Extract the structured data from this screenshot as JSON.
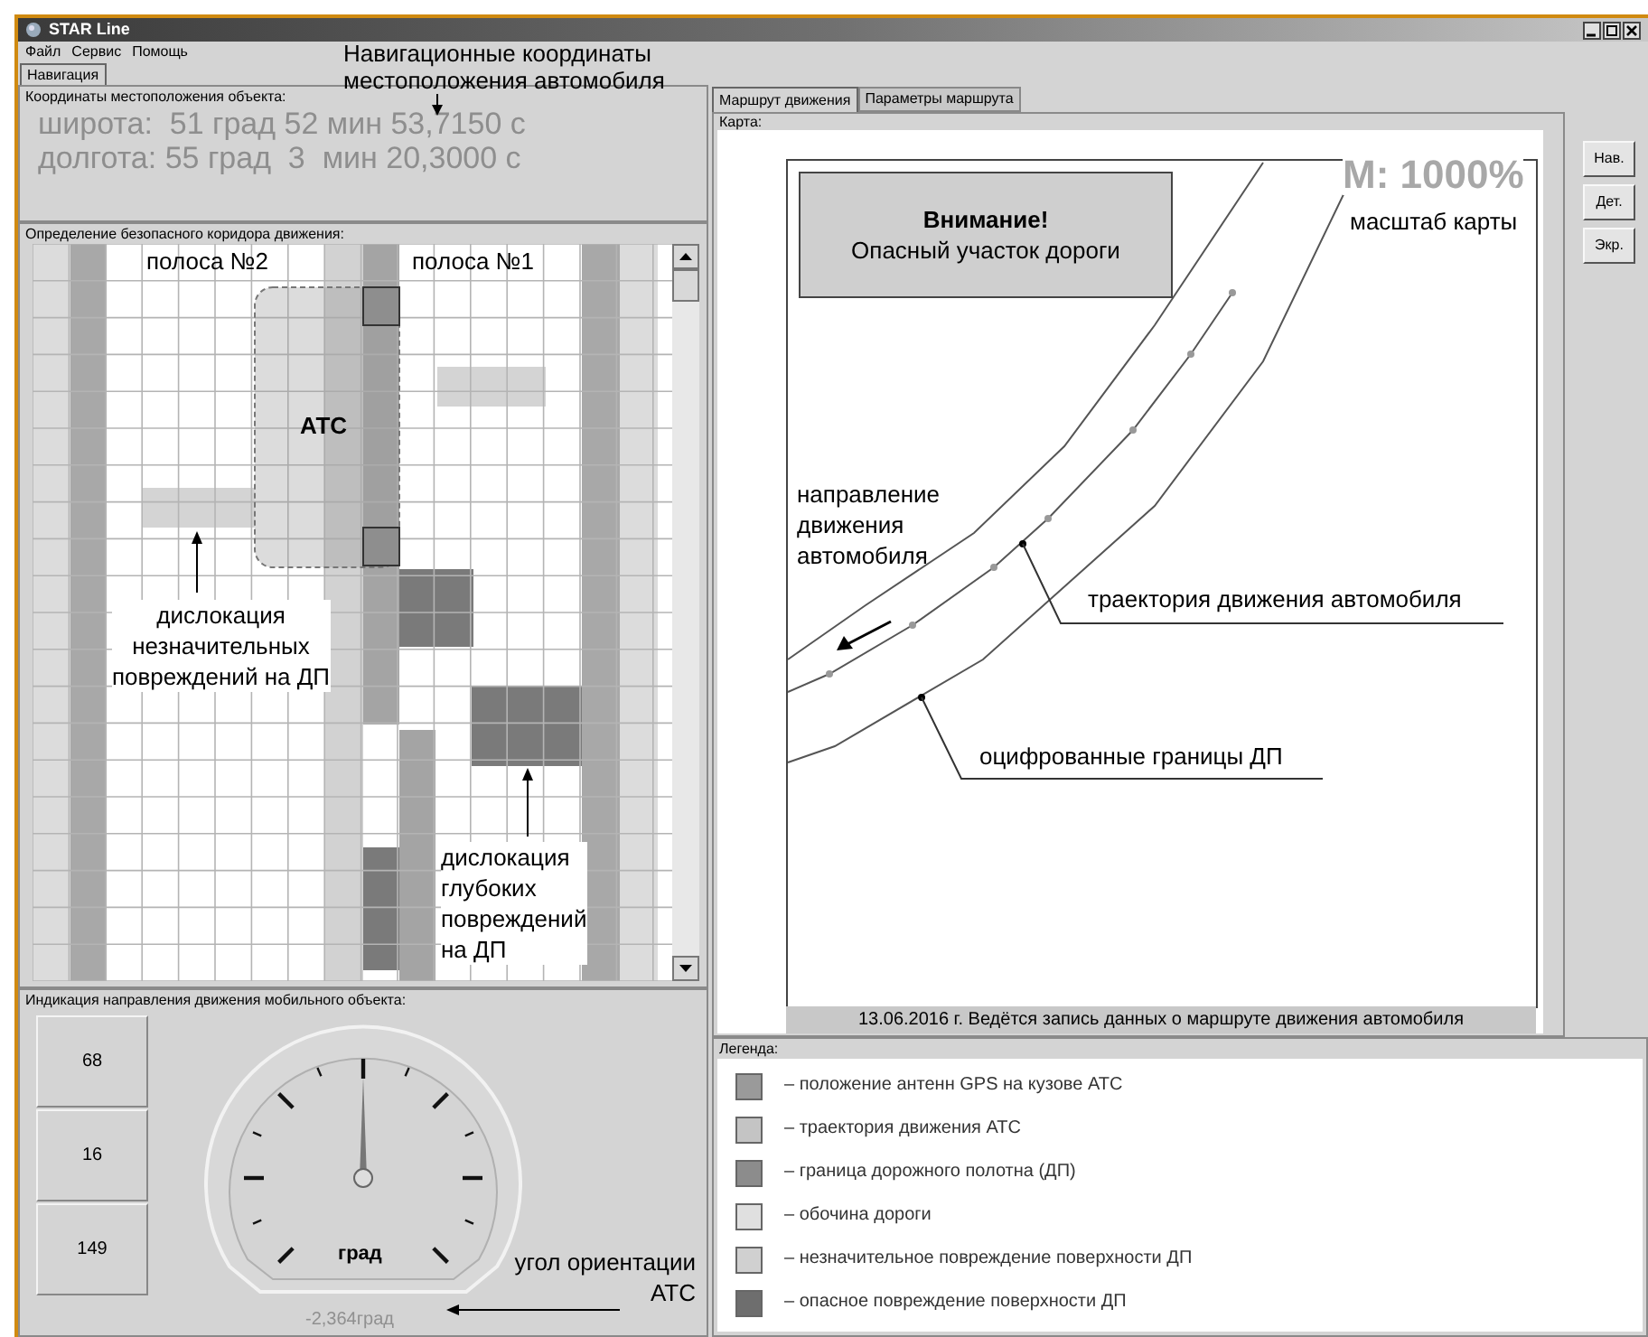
{
  "window": {
    "title": "STAR Line"
  },
  "menu": [
    "Файл",
    "Сервис",
    "Помощь"
  ],
  "top_annotation": "Навигационные координаты\nместоположения автомобиля",
  "left_tabs": [
    {
      "label": "Навигация",
      "selected": true
    }
  ],
  "coordinates": {
    "title": "Координаты местоположения объекта:",
    "latitude": "широта:  51 град 52 мин 53,7150 с",
    "longitude": "долгота: 55 град  3  мин 20,3000 с"
  },
  "corridor": {
    "title": "Определение безопасного коридора движения:",
    "lane_labels": [
      "полоса №2",
      "полоса №1"
    ],
    "vehicle_label": "АТС",
    "annotations": [
      "дислокация\nнезначительных\nповреждений на ДП",
      "дислокация\nглубоких\nповреждений\nна ДП"
    ]
  },
  "direction": {
    "title": "Индикация направления движения мобильного объекта:",
    "readings": [
      "68",
      "16",
      "149"
    ],
    "gauge_unit": "град",
    "angle": "-2,364град",
    "annotation": "угол ориентации\nАТС"
  },
  "right_tabs": [
    {
      "label": "Маршрут движения",
      "selected": true
    },
    {
      "label": "Параметры маршрута",
      "selected": false
    }
  ],
  "map": {
    "title": "Карта:",
    "warning_title": "Внимание!",
    "warning_text": "Опасный участок дороги",
    "scale": "M: 1000%",
    "scale_annotation": "масштаб карты",
    "annotations": [
      "направление\nдвижения\nавтомобиля",
      "траектория движения автомобиля",
      "оцифрованные границы ДП"
    ],
    "status": "13.06.2016 г. Ведётся запись данных о маршруте движения автомобиля"
  },
  "map_buttons": [
    "Нав.",
    "Дет.",
    "Экр."
  ],
  "legend": {
    "title": "Легенда:",
    "items": [
      {
        "color": "#9a9a9a",
        "label": "– положение антенн GPS на кузове АТС"
      },
      {
        "color": "#c4c4c4",
        "label": "– траектория движения АТС"
      },
      {
        "color": "#8c8c8c",
        "label": "– граница дорожного полотна (ДП)"
      },
      {
        "color": "#e0e0e0",
        "label": "– обочина дороги"
      },
      {
        "color": "#d0d0d0",
        "label": "– незначительное повреждение поверхности ДП"
      },
      {
        "color": "#6e6e6e",
        "label": "– опасное повреждение поверхности ДП"
      }
    ]
  }
}
